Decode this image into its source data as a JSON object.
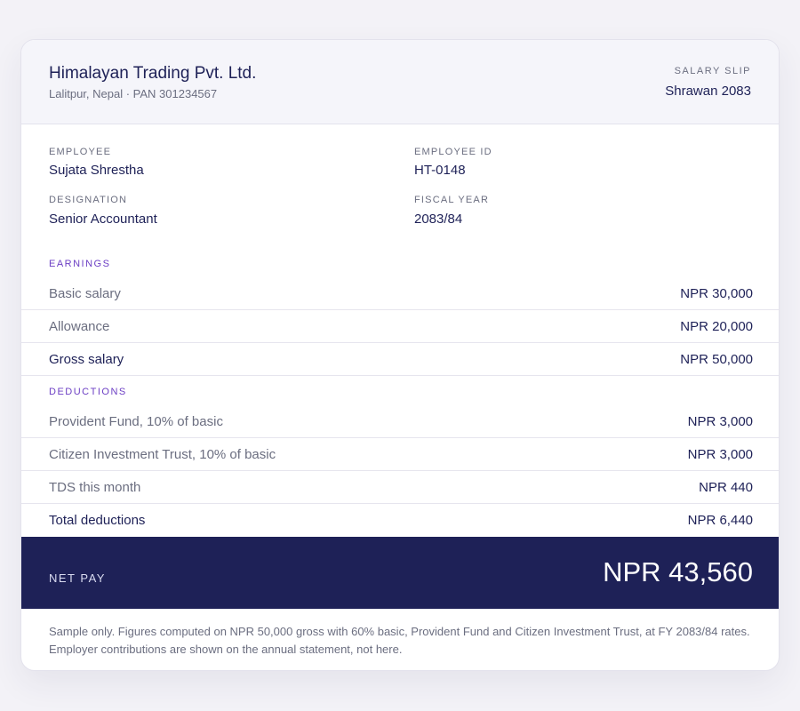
{
  "company": {
    "name": "Himalayan Trading Pvt. Ltd.",
    "meta": "Lalitpur, Nepal · PAN 301234567"
  },
  "slip": {
    "label": "SALARY SLIP",
    "period": "Shrawan 2083"
  },
  "employee": {
    "name_label": "EMPLOYEE",
    "name": "Sujata Shrestha",
    "id_label": "EMPLOYEE ID",
    "id": "HT-0148",
    "designation_label": "DESIGNATION",
    "designation": "Senior Accountant",
    "fiscal_year_label": "FISCAL YEAR",
    "fiscal_year": "2083/84"
  },
  "earnings": {
    "title": "EARNINGS",
    "rows": [
      {
        "label": "Basic salary",
        "amount": "NPR 30,000"
      },
      {
        "label": "Allowance",
        "amount": "NPR 20,000"
      }
    ],
    "total": {
      "label": "Gross salary",
      "amount": "NPR 50,000"
    }
  },
  "deductions": {
    "title": "DEDUCTIONS",
    "rows": [
      {
        "label": "Provident Fund, 10% of basic",
        "amount": "NPR 3,000"
      },
      {
        "label": "Citizen Investment Trust, 10% of basic",
        "amount": "NPR 3,000"
      },
      {
        "label": "TDS this month",
        "amount": "NPR 440"
      }
    ],
    "total": {
      "label": "Total deductions",
      "amount": "NPR 6,440"
    }
  },
  "net_pay": {
    "label": "NET PAY",
    "amount": "NPR 43,560"
  },
  "footnote": {
    "line1": "Sample only. Figures computed on NPR 50,000 gross with 60% basic, Provident Fund and Citizen Investment Trust, at FY 2083/84 rates.",
    "line2": "Employer contributions are shown on the annual statement, not here."
  },
  "colors": {
    "navy": "#1e2157",
    "accent": "#6c3fc4",
    "muted": "#6b6e80",
    "header_bg": "#f5f5fa"
  }
}
